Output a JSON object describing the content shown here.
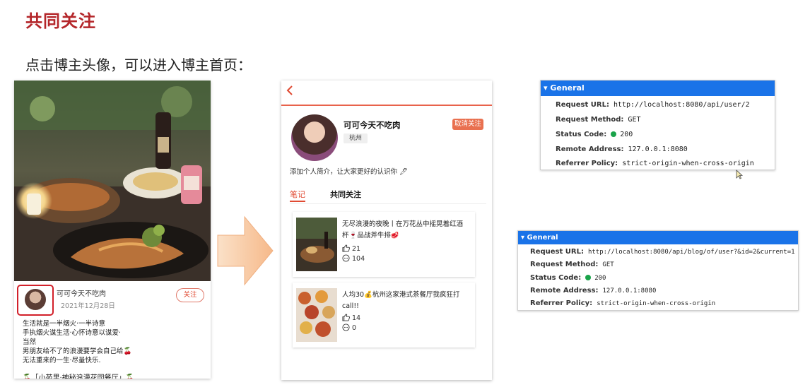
{
  "slide": {
    "title": "共同关注",
    "subtitle": "点击博主头像，可以进入博主首页："
  },
  "left_card": {
    "author_name": "可可今天不吃肉",
    "date": "2021年12月28日",
    "follow_label": "关注",
    "text_lines": [
      "生活就是一半烟火·一半诗意",
      "手执烟火谋生活·心怀诗意以谋爱·",
      "当然",
      "男朋友给不了的浪漫要学会自己给🍒",
      "无法重来的一生·尽量快乐."
    ],
    "footer_line": "🍒「小苑里·神秘浪漫花园餐厅」🍒"
  },
  "phone": {
    "back_icon": "chevron-left-icon",
    "name": "可可今天不吃肉",
    "city": "杭州",
    "unfollow_label": "取消关注",
    "bio": "添加个人简介，让大家更好的认识你 🖊",
    "tabs": [
      "笔记",
      "共同关注"
    ],
    "notes": [
      {
        "title_lines": [
          "无尽浪漫的夜晚丨在万花丛中摇晃着红酒",
          "杯🍷品战斧牛排🥩"
        ],
        "likes": "21",
        "comments": "104"
      },
      {
        "title_lines": [
          "人均30💰杭州这家港式茶餐厅我疯狂打",
          "call!!"
        ],
        "likes": "14",
        "comments": "0"
      }
    ]
  },
  "devtools_top": {
    "header": "General",
    "rows": [
      {
        "label": "Request URL:",
        "value": "http://localhost:8080/api/user/2"
      },
      {
        "label": "Request Method:",
        "value": "GET"
      },
      {
        "label": "Status Code:",
        "value": "200"
      },
      {
        "label": "Remote Address:",
        "value": "127.0.0.1:8080"
      },
      {
        "label": "Referrer Policy:",
        "value": "strict-origin-when-cross-origin"
      }
    ]
  },
  "devtools_bottom": {
    "header": "General",
    "rows": [
      {
        "label": "Request URL:",
        "value": "http://localhost:8080/api/blog/of/user?&id=2&current=1"
      },
      {
        "label": "Request Method:",
        "value": "GET"
      },
      {
        "label": "Status Code:",
        "value": "200"
      },
      {
        "label": "Remote Address:",
        "value": "127.0.0.1:8080"
      },
      {
        "label": "Referrer Policy:",
        "value": "strict-origin-when-cross-origin"
      }
    ]
  },
  "colors": {
    "title_red": "#b4262a",
    "accent_orange": "#e04a32",
    "devtools_blue": "#1a73e8",
    "status_green": "#1aa34a",
    "arrow_fill": "#f8c9a0"
  }
}
